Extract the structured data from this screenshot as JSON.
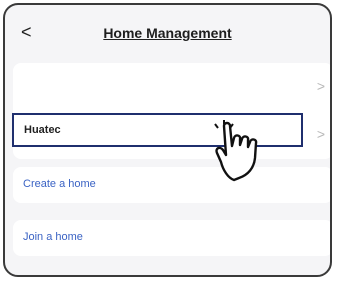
{
  "header": {
    "back_icon": "chevron-left-icon",
    "back_glyph": "<",
    "title": "Home Management"
  },
  "home_list": {
    "items": [
      {
        "name": "",
        "chevron": ">"
      },
      {
        "name": "Huatec",
        "chevron": ">",
        "highlighted": true
      }
    ]
  },
  "actions": {
    "create": "Create a home",
    "join": "Join a home"
  },
  "colors": {
    "link": "#3b63c4",
    "highlight_border": "#1f2f6e",
    "background": "#f5f5f7"
  },
  "overlay": {
    "pointer_icon": "hand-pointer-icon"
  }
}
